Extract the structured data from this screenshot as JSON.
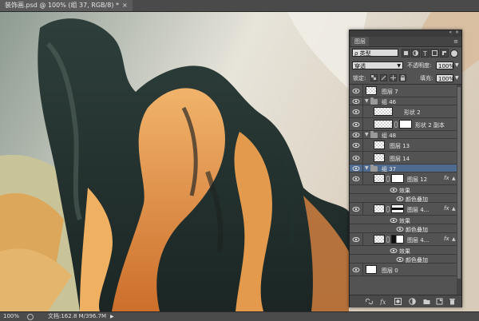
{
  "document_tab": {
    "title": "装饰画.psd @ 100% (组 37, RGB/8) *",
    "close": "×"
  },
  "status_bar": {
    "zoom": "100%",
    "doc_info": "文档:162.8 M/396.7M",
    "arrow": "▶"
  },
  "layers_panel": {
    "tab_label": "图层",
    "menu_icon": "≡",
    "collapse_icon": "«",
    "close_icon": "×",
    "filter": {
      "kind_label": "ρ 类型",
      "icons": [
        "pixel-filter-icon",
        "adjustment-filter-icon",
        "type-filter-icon",
        "shape-filter-icon",
        "smart-object-filter-icon"
      ]
    },
    "blend_mode": "穿透",
    "opacity_label": "不透明度:",
    "opacity_value": "100%",
    "lock_label": "锁定:",
    "fill_label": "填充:",
    "fill_value": "100%",
    "layers": [
      {
        "name": "图层 7",
        "type": "layer",
        "indent": 0
      },
      {
        "name": "组 46",
        "type": "group",
        "indent": 0
      },
      {
        "name": "形状 2",
        "type": "shape",
        "indent": 1
      },
      {
        "name": "形状 2 副本",
        "type": "shape",
        "indent": 1
      },
      {
        "name": "组 48",
        "type": "group",
        "indent": 0
      },
      {
        "name": "图层 13",
        "type": "layer",
        "indent": 1
      },
      {
        "name": "图层 14",
        "type": "layer",
        "indent": 1
      },
      {
        "name": "组 37",
        "type": "group",
        "indent": 0,
        "selected": true
      },
      {
        "name": "图层 12",
        "type": "masked",
        "indent": 1,
        "fx": "fx"
      },
      {
        "name": "效果",
        "type": "effects",
        "indent": 2
      },
      {
        "name": "颜色叠加",
        "type": "effect",
        "indent": 2
      },
      {
        "name": "图层 4...",
        "type": "masked",
        "indent": 1,
        "fx": "fx"
      },
      {
        "name": "效果",
        "type": "effects",
        "indent": 2
      },
      {
        "name": "颜色叠加",
        "type": "effect",
        "indent": 2
      },
      {
        "name": "图层 4...",
        "type": "masked",
        "indent": 1,
        "fx": "fx"
      },
      {
        "name": "效果",
        "type": "effects",
        "indent": 2
      },
      {
        "name": "颜色叠加",
        "type": "effect",
        "indent": 2
      },
      {
        "name": "图层 0",
        "type": "layer",
        "indent": 0
      }
    ],
    "bottom_icons": [
      "link-layers-icon",
      "add-style-icon",
      "add-mask-icon",
      "adjustment-layer-icon",
      "new-group-icon",
      "new-layer-icon",
      "delete-layer-icon"
    ]
  },
  "colors": {
    "panel_bg": "#535353",
    "selected_row": "#4e6a8f",
    "canvas_dark": "#1f2c2a",
    "canvas_orange": "#e89a3f"
  }
}
